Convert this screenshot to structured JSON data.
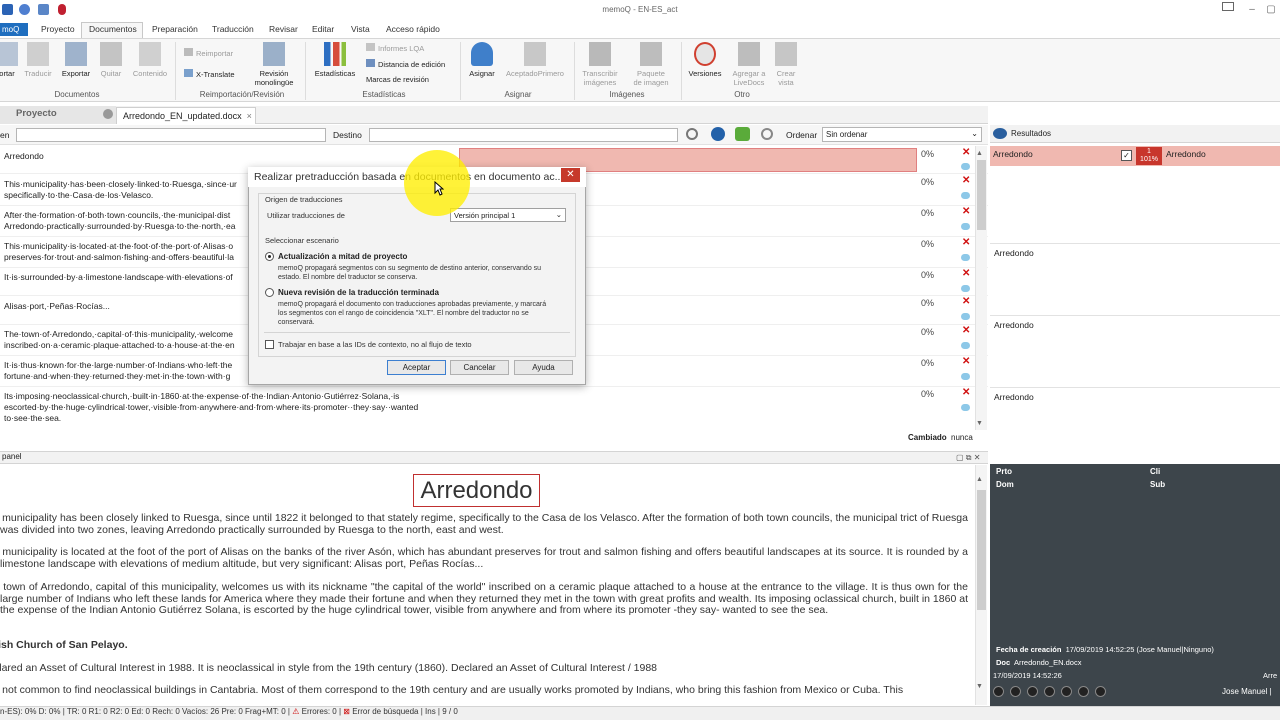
{
  "app": {
    "title": "memoQ - EN-ES_act"
  },
  "menu": {
    "file": "moQ",
    "items": [
      "Proyecto",
      "Documentos",
      "Preparación",
      "Traducción",
      "Revisar",
      "Editar",
      "Vista",
      "Acceso rápido"
    ]
  },
  "ribbon": {
    "documentos": {
      "group": "Documentos",
      "buttons": [
        "ortar",
        "Traducir",
        "Exportar",
        "Quitar",
        "Contenido"
      ]
    },
    "reimport": {
      "group": "Reimportación/Revisión",
      "reimportar": "Reimportar",
      "xtranslate": "X-Translate",
      "revision1": "Revisión",
      "revision2": "monolingüe"
    },
    "estadisticas": {
      "group": "Estadísticas",
      "estadisticas": "Estadísticas",
      "informes": "Informes LQA",
      "distancia": "Distancia de edición",
      "marcas": "Marcas de revisión"
    },
    "asignar": {
      "group": "Asignar",
      "asignar": "Asignar",
      "aceptado": "AceptadoPrimero"
    },
    "imagenes": {
      "group": "Imágenes",
      "transcribir1": "Transcribir",
      "transcribir2": "imágenes",
      "paquete1": "Paquete",
      "paquete2": "de imagen"
    },
    "otro": {
      "group": "Otro",
      "versiones": "Versiones",
      "agregar1": "Agregar a",
      "agregar2": "LiveDocs",
      "crear1": "Crear",
      "crear2": "vista"
    }
  },
  "tabs": {
    "proyecto": "Proyecto",
    "document": "Arredondo_EN_updated.docx"
  },
  "filter": {
    "source_label": "en",
    "target_label": "Destino",
    "sort_label": "Ordenar",
    "sort_value": "Sin ordenar"
  },
  "segments": [
    {
      "src1": "Arredondo",
      "src2": "",
      "pct": "0%"
    },
    {
      "src1": "This·municipality·has·been·closely·linked·to·Ruesga,·since·ur",
      "src2": "specifically·to·the·Casa·de·los·Velasco.",
      "pct": "0%"
    },
    {
      "src1": "After·the·formation·of·both·town·councils,·the·municipal·dist",
      "src2": "Arredondo·practically·surrounded·by·Ruesga·to·the·north,·ea",
      "pct": "0%"
    },
    {
      "src1": "This·municipality·is·located·at·the·foot·of·the·port·of·Alisas·o",
      "src2": "preserves·for·trout·and·salmon·fishing·and·offers·beautiful·la",
      "pct": "0%"
    },
    {
      "src1": "It·is·surrounded·by·a·limestone·landscape·with·elevations·of",
      "src2": "",
      "pct": "0%"
    },
    {
      "src1": "Alisas·port,·Peñas·Rocías...",
      "src2": "",
      "pct": "0%"
    },
    {
      "src1": "The·town·of·Arredondo,·capital·of·this·municipality,·welcome",
      "src2": "inscribed·on·a·ceramic·plaque·attached·to·a·house·at·the·en",
      "pct": "0%"
    },
    {
      "src1": "It·is·thus·known·for·the·large·number·of·Indians·who·left·the",
      "src2": "fortune·and·when·they·returned·they·met·in·the·town·with·g",
      "pct": "0%"
    },
    {
      "src1": "Its·imposing·neoclassical·church,·built·in·1860·at·the·expense·of·the·Indian·Antonio·Gutiérrez·Solana,·is",
      "src2": "escorted·by·the·huge·cylindrical·tower,·visible·from·anywhere·and·from·where·its·promoter··they·say··wanted",
      "src3": "to·see·the·sea.",
      "pct": "0%"
    }
  ],
  "grid_status": {
    "cambiado": "Cambiado",
    "nunca": "nunca"
  },
  "preview": {
    "header": "panel",
    "title": "Arredondo",
    "p1": "s municipality has been closely linked to Ruesga, since until 1822 it belonged to that stately regime, specifically to the Casa de los Velasco. After the formation of both town councils, the municipal trict of Ruesga was divided into two zones, leaving Arredondo practically surrounded by Ruesga to the north, east and west.",
    "p2": "s municipality is located at the foot of the port of Alisas on the banks of the river Asón, which has abundant preserves for trout and salmon fishing and offers beautiful landscapes at its source. It is rounded by a limestone landscape with elevations of medium altitude, but very significant: Alisas port, Peñas Rocías...",
    "p3": "e town of Arredondo, capital of this municipality, welcomes us with its nickname \"the capital of the world\" inscribed on a ceramic plaque attached to a house at the entrance to the village. It is thus own for the large number of Indians who left these lands for America where they made their fortune and when they returned they met in the town with great profits and wealth. Its imposing oclassical church, built in 1860 at the expense of the Indian Antonio Gutiérrez Solana, is escorted by the huge cylindrical tower, visible from anywhere and from where its promoter -they say- wanted to see the sea.",
    "h2": "rish Church of San Pelayo.",
    "p4": "clared an Asset of Cultural Interest in 1988. It is neoclassical in style from the 19th century (1860). Declared an Asset of Cultural Interest / 1988",
    "p5": "s not common to find neoclassical buildings in Cantabria. Most of them correspond to the 19th century and are usually works promoted by Indians, who bring this fashion from Mexico or Cuba. This"
  },
  "results": {
    "header": "Resultados",
    "hit_src": "Arredondo",
    "hit_rank": "1",
    "hit_pct": "101%",
    "hit_tgt": "Arredondo",
    "box1": "Arredondo",
    "box2": "Arredondo",
    "box3": "Arredondo",
    "meta": {
      "prto": "Prto",
      "cli": "Cli",
      "dom": "Dom",
      "sub": "Sub",
      "fecha_label": "Fecha de creación",
      "fecha_value": "17/09/2019 14:52:25 (Jose Manuel|Ninguno)",
      "doc_label": "Doc",
      "doc_value": "Arredondo_EN.docx",
      "stamp": "17/09/2019 14:52:26",
      "user": "Jose Manuel  |",
      "arre": "Arre"
    }
  },
  "statusbar": {
    "text": "n-ES): 0%  D: 0%  |  TR: 0  R1: 0  R2: 0  Ed: 0  Rech: 0  Vacíos: 26  Pre: 0  Frag+MT: 0 |",
    "errores": "Errores: 0",
    "busqueda": "Error de búsqueda",
    "ins": "Ins",
    "pages": "9 / 0"
  },
  "dialog": {
    "title": "Realizar pretraducción basada en documentos en documento ac...",
    "origen_label": "Origen de traducciones",
    "usar_label": "Utilizar traducciones de",
    "usar_value": "Versión principal 1",
    "escenario_label": "Seleccionar escenario",
    "opt1_title": "Actualización a mitad de proyecto",
    "opt1_desc1": "memoQ propagará segmentos con su segmento de destino anterior, conservando su",
    "opt1_desc2": "estado. El nombre del traductor se conserva.",
    "opt2_title": "Nueva revisión de la traducción terminada",
    "opt2_desc1": "memoQ propagará el documento con traducciones aprobadas previamente, y marcará",
    "opt2_desc2": "los segmentos con el rango de coincidencia \"XLT\". El nombre del traductor no se",
    "opt2_desc3": "conservará.",
    "checkbox_label": "Trabajar en base a las IDs de contexto, no al flujo de texto",
    "accept": "Aceptar",
    "cancel": "Cancelar",
    "help": "Ayuda"
  },
  "colors": {
    "accent": "#1f6ebf",
    "match_row": "#f0b8b0",
    "close_red": "#c6392b",
    "dark_panel": "#3d454b"
  }
}
